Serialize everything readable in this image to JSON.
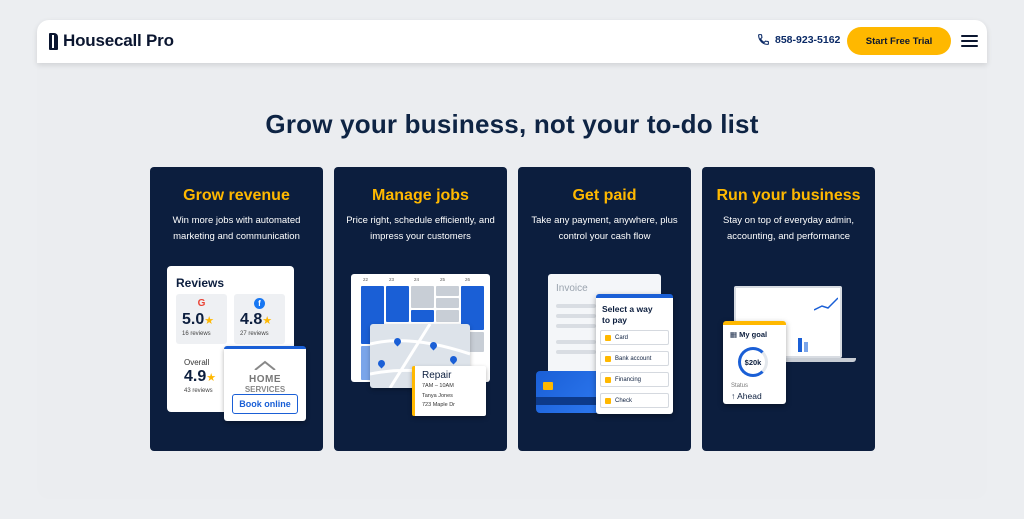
{
  "nav": {
    "logo_text": "Housecall Pro",
    "phone": "858-923-5162",
    "cta_label": "Start Free Trial"
  },
  "headline": "Grow your business, not your to-do list",
  "cards": [
    {
      "title": "Grow revenue",
      "desc": "Win more jobs with automated marketing and communication",
      "reviews": {
        "title": "Reviews",
        "google_icon": "G",
        "google_score": "5.0",
        "google_count": "16 reviews",
        "facebook_icon": "f",
        "facebook_score": "4.8",
        "facebook_count": "27 reviews",
        "overall_label": "Overall",
        "overall_score": "4.9",
        "overall_count": "43 reviews",
        "star": "★"
      },
      "home_services": {
        "line1": "HOME",
        "line2": "SERVICES",
        "button": "Book online"
      }
    },
    {
      "title": "Manage jobs",
      "desc": "Price right, schedule efficiently, and impress your customers",
      "calendar_days": [
        "22",
        "23",
        "24",
        "25",
        "26"
      ],
      "job": {
        "title": "Repair",
        "time": "7AM – 10AM",
        "name": "Tanya Jones",
        "address": "723 Maple Dr"
      }
    },
    {
      "title": "Get paid",
      "desc": "Take any payment, anywhere, plus control your cash flow",
      "invoice_title": "Invoice",
      "pay_title": "Select a way to pay",
      "pay_options": [
        "Card",
        "Bank account",
        "Financing",
        "Check"
      ]
    },
    {
      "title": "Run your business",
      "desc": "Stay on top of everyday admin, accounting, and performance",
      "goal": {
        "title": "My goal",
        "value": "$20k",
        "status_label": "Status",
        "status_value": "↑ Ahead"
      }
    }
  ],
  "colors": {
    "navy": "#0c1e3e",
    "accent": "#ffb800",
    "blue": "#1a5fd6"
  }
}
